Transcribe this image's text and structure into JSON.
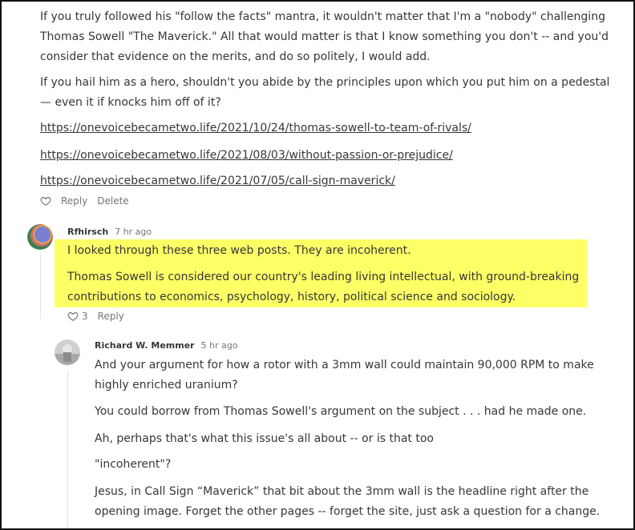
{
  "comment1": {
    "paragraph1": "If you truly followed his \"follow the facts\" mantra, it wouldn't matter that I'm a \"nobody\" challenging Thomas Sowell \"The Maverick.\" All that would matter is that I know something you don't -- and you'd consider that evidence on the merits, and do so politely, I would add.",
    "paragraph1_lines": [
      "If you truly followed his \"follow the facts\" mantra, it wouldn't matter that I'm a \"nobody\" challenging",
      "Thomas Sowell \"The Maverick.\" All that would matter is that I know something you don't -- and you'd",
      "consider that evidence on the merits, and do so politely, I would add."
    ],
    "paragraph2_lines": [
      "If you hail him as a hero, shouldn't you abide by the principles upon which you put him on a pedestal",
      "— even it if knocks him off of it?"
    ],
    "links": [
      "https://onevoicebecametwo.life/2021/10/24/thomas-sowell-to-team-of-rivals/",
      "https://onevoicebecametwo.life/2021/08/03/without-passion-or-prejudice/",
      "https://onevoicebecametwo.life/2021/07/05/call-sign-maverick/"
    ],
    "reply_label": "Reply",
    "delete_label": "Delete"
  },
  "comment2": {
    "author": "Rfhirsch",
    "time": "7 hr ago",
    "paragraph1": "I looked through these three web posts. They are incoherent.",
    "paragraph2_lines": [
      "Thomas Sowell is considered our country's leading living intellectual, with ground-breaking",
      "contributions to economics, psychology, history, political science and sociology."
    ],
    "like_count": "3",
    "reply_label": "Reply",
    "highlight_color": "#ffff66"
  },
  "comment3": {
    "author": "Richard W. Memmer",
    "time": "5 hr ago",
    "paragraph1_lines": [
      "And your argument for how a rotor with a 3mm wall could maintain 90,000 RPM to make",
      "highly enriched uranium?"
    ],
    "paragraph2": "You could borrow from Thomas Sowell's argument on the subject . . . had he made one.",
    "paragraph3": "Ah, perhaps that's what this issue's all about -- or is that too",
    "paragraph4": "\"incoherent\"?",
    "paragraph5_lines": [
      "Jesus, in Call Sign “Maverick” that bit about the 3mm wall is the headline right after the",
      "opening image. Forget the other pages -- forget the site, just ask a question for a change."
    ]
  }
}
